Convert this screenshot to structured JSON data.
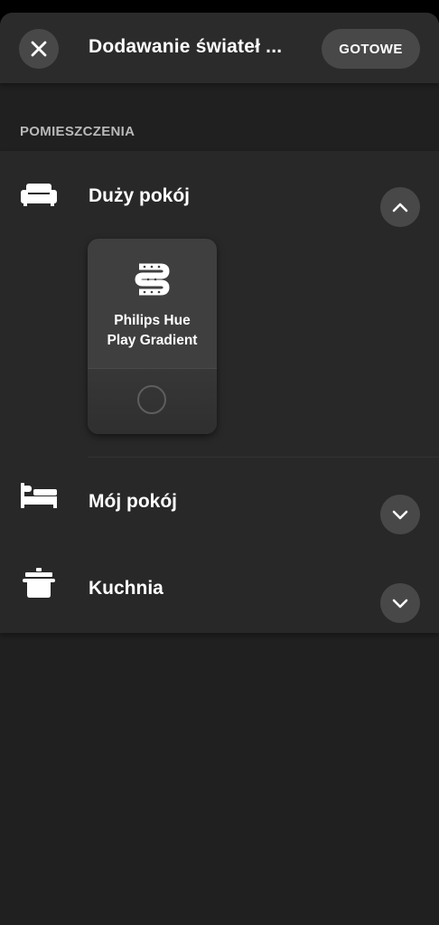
{
  "header": {
    "close_icon": "close-icon",
    "title": "Dodawanie świateł ...",
    "done_label": "GOTOWE"
  },
  "section": {
    "label": "POMIESZCZENIA"
  },
  "rooms": [
    {
      "name": "Duży pokój",
      "icon": "sofa-icon",
      "expanded": true,
      "chevron": "chevron-up-icon"
    },
    {
      "name": "Mój pokój",
      "icon": "bed-icon",
      "expanded": false,
      "chevron": "chevron-down-icon"
    },
    {
      "name": "Kuchnia",
      "icon": "pot-icon",
      "expanded": false,
      "chevron": "chevron-down-icon"
    }
  ],
  "lights": [
    {
      "name_line1": "Philips Hue",
      "name_line2": "Play Gradient",
      "icon": "lightstrip-icon",
      "selected": false
    }
  ],
  "colors": {
    "background": "#202020",
    "panel": "#282828",
    "button": "#484848",
    "text": "#ffffff",
    "muted_text": "#b9b9b9"
  }
}
